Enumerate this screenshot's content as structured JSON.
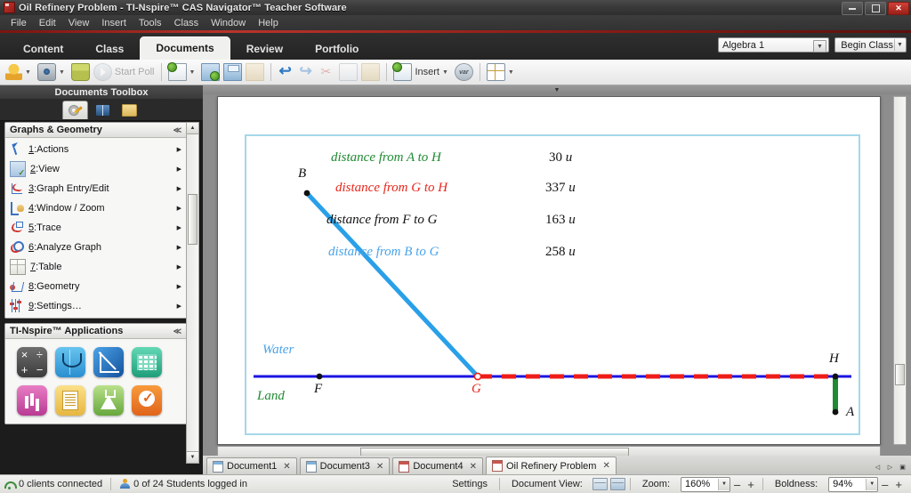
{
  "window": {
    "title": "Oil Refinery Problem - TI-Nspire™ CAS Navigator™ Teacher Software",
    "minimize": "–",
    "maximize": "□",
    "close": "✕"
  },
  "menubar": {
    "items": [
      "File",
      "Edit",
      "View",
      "Insert",
      "Tools",
      "Class",
      "Window",
      "Help"
    ]
  },
  "ribbon": {
    "tabs": [
      {
        "label": "Content",
        "active": false
      },
      {
        "label": "Class",
        "active": false
      },
      {
        "label": "Documents",
        "active": true
      },
      {
        "label": "Review",
        "active": false
      },
      {
        "label": "Portfolio",
        "active": false
      }
    ],
    "class_select": "Algebra 1",
    "begin_class": "Begin Class"
  },
  "toolbar": {
    "start_poll": "Start Poll",
    "insert": "Insert",
    "icons": [
      "teacher-tool-icon",
      "screen-capture-icon",
      "collect-icon",
      "start-poll-icon",
      "new-document-icon",
      "open-document-icon",
      "save-document-icon",
      "save-all-icon",
      "undo-icon",
      "redo-icon",
      "cut-icon",
      "copy-icon",
      "paste-icon",
      "insert-page-icon",
      "variables-icon",
      "layout-icon"
    ]
  },
  "toolbox": {
    "title": "Documents Toolbox",
    "tabs": [
      "tools-tab",
      "utilities-tab",
      "content-explorer-tab"
    ],
    "group_title": "Graphs & Geometry",
    "menu": [
      {
        "num": "1",
        "label": ":Actions"
      },
      {
        "num": "2",
        "label": ":View"
      },
      {
        "num": "3",
        "label": ":Graph Entry/Edit"
      },
      {
        "num": "4",
        "label": ":Window / Zoom"
      },
      {
        "num": "5",
        "label": ":Trace"
      },
      {
        "num": "6",
        "label": ":Analyze Graph"
      },
      {
        "num": "7",
        "label": ":Table"
      },
      {
        "num": "8",
        "label": ":Geometry"
      },
      {
        "num": "9",
        "label": ":Settings…"
      }
    ],
    "apps_title": "TI-Nspire™ Applications",
    "apps": [
      "calculator-app-icon",
      "graphs-app-icon",
      "geometry-app-icon",
      "lists-spreadsheet-app-icon",
      "data-statistics-app-icon",
      "notes-app-icon",
      "vernier-datacollection-app-icon",
      "quick-poll-app-icon"
    ]
  },
  "canvas": {
    "measurements": [
      {
        "text": "distance from A to H",
        "value": "30",
        "unit": "u",
        "color": "#1f8a32"
      },
      {
        "text": "distance from G to H",
        "value": "337",
        "unit": "u",
        "color": "#e8261c"
      },
      {
        "text": "distance from F to G",
        "value": "163",
        "unit": "u",
        "color": "#111111"
      },
      {
        "text": "distance from B to G",
        "value": "258",
        "unit": "u",
        "color": "#4aa3e8"
      }
    ],
    "point_labels": [
      "B",
      "F",
      "G",
      "H",
      "A"
    ],
    "region_labels": [
      {
        "text": "Water",
        "color": "#4aa3e8"
      },
      {
        "text": "Land",
        "color": "#1f8a32"
      }
    ],
    "colors": {
      "shoreline": "#1a13e0",
      "pipe_water": "#29a0e8",
      "pipe_land_dashed": "#ee1c18",
      "refinery_segment": "#1f8a32",
      "frame": "#a5d7ea"
    }
  },
  "doctabs": {
    "tabs": [
      {
        "label": "Document1",
        "active": false,
        "color": "blue"
      },
      {
        "label": "Document3",
        "active": false,
        "color": "blue"
      },
      {
        "label": "Document4",
        "active": false,
        "color": "red"
      },
      {
        "label": "Oil Refinery Problem",
        "active": true,
        "color": "red"
      }
    ],
    "close_glyph": "✕",
    "nav": [
      "◁",
      "▷",
      "▣"
    ]
  },
  "statusbar": {
    "clients": "0 clients connected",
    "students": "0 of 24 Students logged in",
    "settings": "Settings",
    "document_view": "Document View:",
    "zoom_label": "Zoom:",
    "zoom_value": "160%",
    "boldness_label": "Boldness:",
    "boldness_value": "94%",
    "minus": "–",
    "plus": "+"
  }
}
